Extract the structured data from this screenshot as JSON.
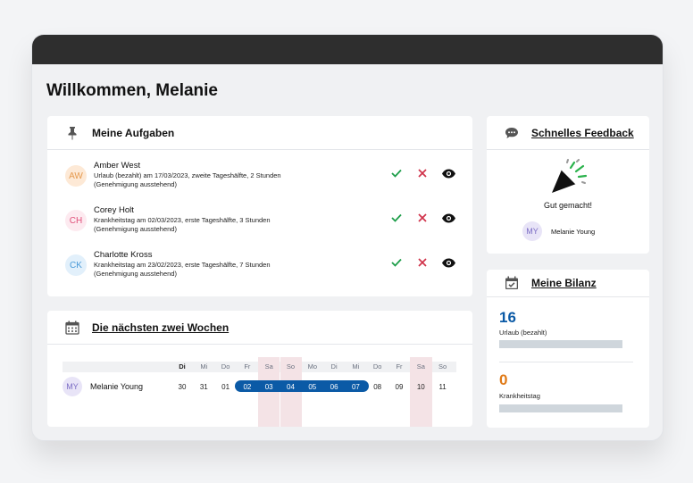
{
  "greeting": "Willkommen, Melanie",
  "tasks": {
    "title": "Meine Aufgaben",
    "items": [
      {
        "initials": "AW",
        "name": "Amber West",
        "line1": "Urlaub (bezahlt) am 17/03/2023, zweite Tageshälfte, 2 Stunden",
        "line2": "(Genehmigung ausstehend)",
        "avatar_bg": "#fde9d6",
        "avatar_fg": "#e59a4f"
      },
      {
        "initials": "CH",
        "name": "Corey Holt",
        "line1": "Krankheitstag am 02/03/2023, erste Tageshälfte, 3 Stunden",
        "line2": "(Genehmigung ausstehend)",
        "avatar_bg": "#fdeaf0",
        "avatar_fg": "#e0507a"
      },
      {
        "initials": "CK",
        "name": "Charlotte Kross",
        "line1": "Krankheitstag am 23/02/2023, erste Tageshälfte, 7 Stunden",
        "line2": "(Genehmigung ausstehend)",
        "avatar_bg": "#e2f0fb",
        "avatar_fg": "#4a9ad8"
      }
    ]
  },
  "feedback": {
    "title": "Schnelles Feedback",
    "message": "Gut gemacht!",
    "user_initials": "MY",
    "user_name": "Melanie Young"
  },
  "balance": {
    "title": "Meine Bilanz",
    "items": [
      {
        "value": "16",
        "label": "Urlaub (bezahlt)",
        "color": "#0b5aa6"
      },
      {
        "value": "0",
        "label": "Krankheitstag",
        "color": "#e07a18"
      }
    ]
  },
  "schedule": {
    "title": "Die nächsten zwei Wochen",
    "user_initials": "MY",
    "user_name": "Melanie Young",
    "days": [
      {
        "label": "Di",
        "date": "30",
        "weekend": false,
        "leave": false,
        "today": true
      },
      {
        "label": "Mi",
        "date": "31",
        "weekend": false,
        "leave": false,
        "today": false
      },
      {
        "label": "Do",
        "date": "01",
        "weekend": false,
        "leave": false,
        "today": false
      },
      {
        "label": "Fr",
        "date": "02",
        "weekend": false,
        "leave": true,
        "today": false
      },
      {
        "label": "Sa",
        "date": "03",
        "weekend": true,
        "leave": true,
        "today": false
      },
      {
        "label": "So",
        "date": "04",
        "weekend": true,
        "leave": true,
        "today": false
      },
      {
        "label": "Mo",
        "date": "05",
        "weekend": false,
        "leave": true,
        "today": false
      },
      {
        "label": "Di",
        "date": "06",
        "weekend": false,
        "leave": true,
        "today": false
      },
      {
        "label": "Mi",
        "date": "07",
        "weekend": false,
        "leave": true,
        "today": false
      },
      {
        "label": "Do",
        "date": "08",
        "weekend": false,
        "leave": false,
        "today": false
      },
      {
        "label": "Fr",
        "date": "09",
        "weekend": false,
        "leave": false,
        "today": false
      },
      {
        "label": "Sa",
        "date": "10",
        "weekend": true,
        "leave": false,
        "today": false
      },
      {
        "label": "So",
        "date": "11",
        "weekend": false,
        "leave": false,
        "today": false
      }
    ]
  },
  "colors": {
    "approve": "#1e9e4a",
    "reject": "#d0334a",
    "accent": "#0b5aa6",
    "avatar_my_bg": "#e8e4f7",
    "avatar_my_fg": "#7b6cc4"
  }
}
